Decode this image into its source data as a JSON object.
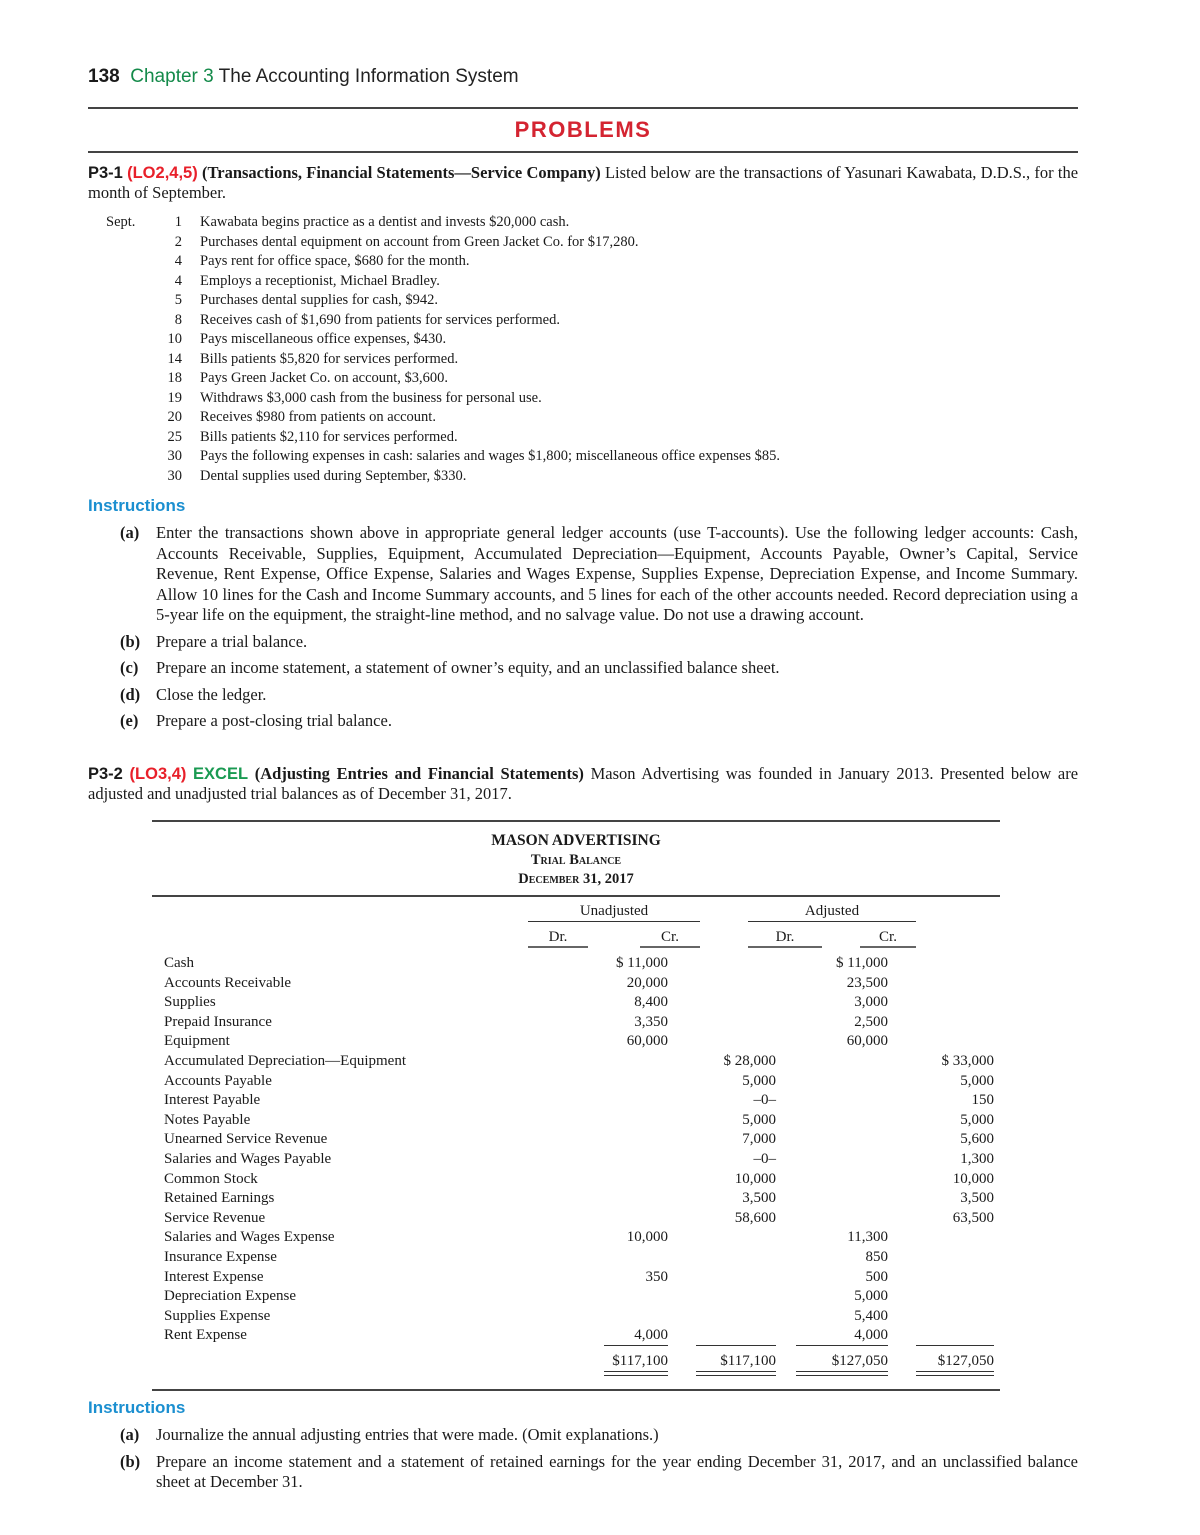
{
  "header": {
    "page_number": "138",
    "chapter": "Chapter 3",
    "chapter_title": "The Accounting Information System",
    "section_title": "PROBLEMS"
  },
  "colors": {
    "chapter": "#148a4a",
    "problems_title": "#d42431",
    "learning_objective": "#e8202a",
    "excel_badge": "#1a9a52",
    "instructions_heading": "#1b8fd0"
  },
  "p3_1": {
    "number": "P3-1",
    "learning_objectives": "(LO2,4,5)",
    "topic": "(Transactions, Financial Statements—Service Company)",
    "intro": "Listed below are the transactions of Yasunari Kawabata, D.D.S., for the month of September.",
    "month": "Sept.",
    "transactions": [
      {
        "day": "1",
        "text": "Kawabata begins practice as a dentist and invests $20,000 cash."
      },
      {
        "day": "2",
        "text": "Purchases dental equipment on account from Green Jacket Co. for $17,280."
      },
      {
        "day": "4",
        "text": "Pays rent for office space, $680 for the month."
      },
      {
        "day": "4",
        "text": "Employs a receptionist, Michael Bradley."
      },
      {
        "day": "5",
        "text": "Purchases dental supplies for cash, $942."
      },
      {
        "day": "8",
        "text": "Receives cash of $1,690 from patients for services performed."
      },
      {
        "day": "10",
        "text": "Pays miscellaneous office expenses, $430."
      },
      {
        "day": "14",
        "text": "Bills patients $5,820 for services performed."
      },
      {
        "day": "18",
        "text": "Pays Green Jacket Co. on account, $3,600."
      },
      {
        "day": "19",
        "text": "Withdraws $3,000 cash from the business for personal use."
      },
      {
        "day": "20",
        "text": "Receives $980 from patients on account."
      },
      {
        "day": "25",
        "text": "Bills patients $2,110 for services performed."
      },
      {
        "day": "30",
        "text": "Pays the following expenses in cash: salaries and wages $1,800; miscellaneous office expenses $85."
      },
      {
        "day": "30",
        "text": "Dental supplies used during September, $330."
      }
    ],
    "instructions_heading": "Instructions",
    "instructions": [
      {
        "label": "(a)",
        "text": "Enter the transactions shown above in appropriate general ledger accounts (use T-accounts). Use the following ledger accounts: Cash, Accounts Receivable, Supplies, Equipment, Accumulated Depreciation—Equipment, Accounts Payable, Owner’s Capital, Service Revenue, Rent Expense, Office Expense, Salaries and Wages Expense, Supplies Expense, Depreciation Expense, and Income Summary. Allow 10 lines for the Cash and Income Summary accounts, and 5 lines for each of the other accounts needed. Record depreciation using a 5-year life on the equipment, the straight-line method, and no salvage value. Do not use a drawing account."
      },
      {
        "label": "(b)",
        "text": "Prepare a trial balance."
      },
      {
        "label": "(c)",
        "text": "Prepare an income statement, a statement of owner’s equity, and an unclassified balance sheet."
      },
      {
        "label": "(d)",
        "text": "Close the ledger."
      },
      {
        "label": "(e)",
        "text": "Prepare a post-closing trial balance."
      }
    ]
  },
  "p3_2": {
    "number": "P3-2",
    "learning_objectives": "(LO3,4)",
    "excel": "EXCEL",
    "topic": "(Adjusting Entries and Financial Statements)",
    "intro": "Mason Advertising was founded in January 2013. Presented below are adjusted and unadjusted trial balances as of December 31, 2017.",
    "trial_balance": {
      "company": "MASON ADVERTISING",
      "title": "Trial Balance",
      "date": "December 31, 2017",
      "groups": [
        "Unadjusted",
        "Adjusted"
      ],
      "columns": [
        "Dr.",
        "Cr.",
        "Dr.",
        "Cr."
      ],
      "rows": [
        {
          "account": "Cash",
          "unadj_dr": "$ 11,000",
          "unadj_cr": "",
          "adj_dr": "$ 11,000",
          "adj_cr": ""
        },
        {
          "account": "Accounts Receivable",
          "unadj_dr": "20,000",
          "unadj_cr": "",
          "adj_dr": "23,500",
          "adj_cr": ""
        },
        {
          "account": "Supplies",
          "unadj_dr": "8,400",
          "unadj_cr": "",
          "adj_dr": "3,000",
          "adj_cr": ""
        },
        {
          "account": "Prepaid Insurance",
          "unadj_dr": "3,350",
          "unadj_cr": "",
          "adj_dr": "2,500",
          "adj_cr": ""
        },
        {
          "account": "Equipment",
          "unadj_dr": "60,000",
          "unadj_cr": "",
          "adj_dr": "60,000",
          "adj_cr": ""
        },
        {
          "account": "Accumulated Depreciation—Equipment",
          "unadj_dr": "",
          "unadj_cr": "$ 28,000",
          "adj_dr": "",
          "adj_cr": "$ 33,000"
        },
        {
          "account": "Accounts Payable",
          "unadj_dr": "",
          "unadj_cr": "5,000",
          "adj_dr": "",
          "adj_cr": "5,000"
        },
        {
          "account": "Interest Payable",
          "unadj_dr": "",
          "unadj_cr": "–0–",
          "adj_dr": "",
          "adj_cr": "150"
        },
        {
          "account": "Notes Payable",
          "unadj_dr": "",
          "unadj_cr": "5,000",
          "adj_dr": "",
          "adj_cr": "5,000"
        },
        {
          "account": "Unearned Service Revenue",
          "unadj_dr": "",
          "unadj_cr": "7,000",
          "adj_dr": "",
          "adj_cr": "5,600"
        },
        {
          "account": "Salaries and Wages Payable",
          "unadj_dr": "",
          "unadj_cr": "–0–",
          "adj_dr": "",
          "adj_cr": "1,300"
        },
        {
          "account": "Common Stock",
          "unadj_dr": "",
          "unadj_cr": "10,000",
          "adj_dr": "",
          "adj_cr": "10,000"
        },
        {
          "account": "Retained Earnings",
          "unadj_dr": "",
          "unadj_cr": "3,500",
          "adj_dr": "",
          "adj_cr": "3,500"
        },
        {
          "account": "Service Revenue",
          "unadj_dr": "",
          "unadj_cr": "58,600",
          "adj_dr": "",
          "adj_cr": "63,500"
        },
        {
          "account": "Salaries and Wages Expense",
          "unadj_dr": "10,000",
          "unadj_cr": "",
          "adj_dr": "11,300",
          "adj_cr": ""
        },
        {
          "account": "Insurance Expense",
          "unadj_dr": "",
          "unadj_cr": "",
          "adj_dr": "850",
          "adj_cr": ""
        },
        {
          "account": "Interest Expense",
          "unadj_dr": "350",
          "unadj_cr": "",
          "adj_dr": "500",
          "adj_cr": ""
        },
        {
          "account": "Depreciation Expense",
          "unadj_dr": "",
          "unadj_cr": "",
          "adj_dr": "5,000",
          "adj_cr": ""
        },
        {
          "account": "Supplies Expense",
          "unadj_dr": "",
          "unadj_cr": "",
          "adj_dr": "5,400",
          "adj_cr": ""
        },
        {
          "account": "Rent Expense",
          "unadj_dr": "4,000",
          "unadj_cr": "",
          "adj_dr": "4,000",
          "adj_cr": ""
        }
      ],
      "totals": {
        "unadj_dr": "$117,100",
        "unadj_cr": "$117,100",
        "adj_dr": "$127,050",
        "adj_cr": "$127,050"
      }
    },
    "instructions_heading": "Instructions",
    "instructions": [
      {
        "label": "(a)",
        "text": "Journalize the annual adjusting entries that were made. (Omit explanations.)"
      },
      {
        "label": "(b)",
        "text": "Prepare an income statement and a statement of retained earnings for the year ending December 31, 2017, and an unclassified balance sheet at December 31."
      }
    ]
  }
}
